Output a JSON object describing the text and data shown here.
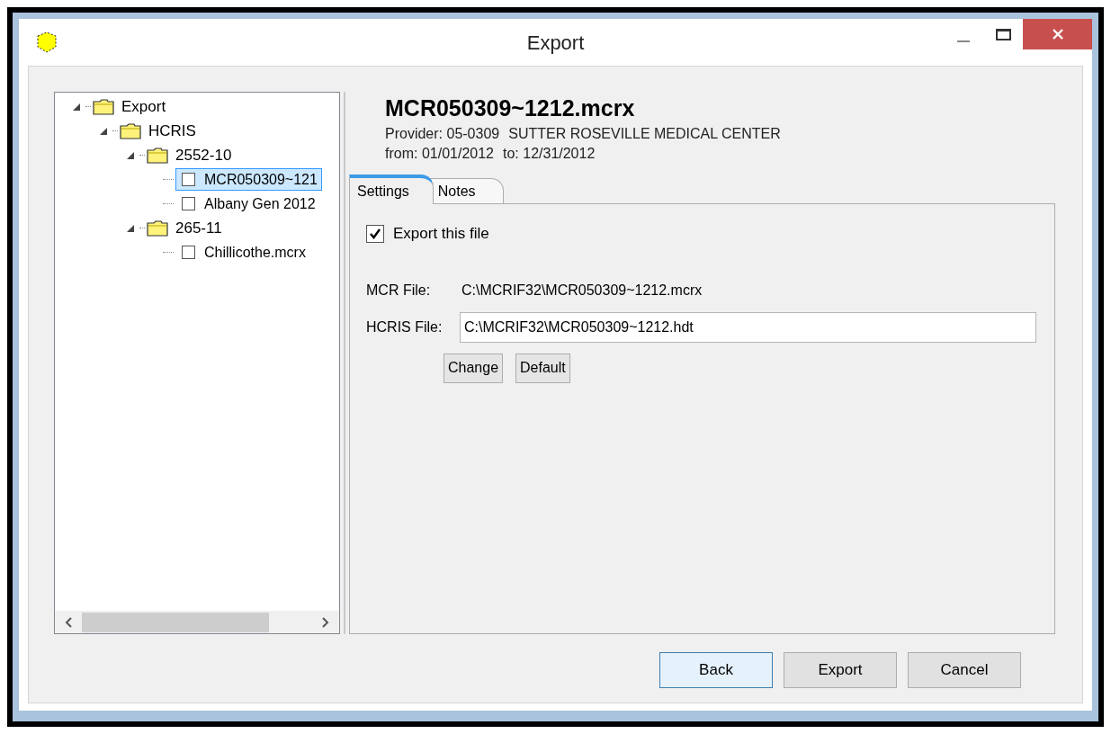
{
  "window": {
    "title": "Export"
  },
  "tree": [
    {
      "kind": "folder",
      "label": "Export",
      "expanded": true,
      "children": [
        {
          "kind": "folder",
          "label": "HCRIS",
          "expanded": true,
          "children": [
            {
              "kind": "folder",
              "label": "2552-10",
              "expanded": true,
              "children": [
                {
                  "kind": "file",
                  "label": "MCR050309~121",
                  "checked": false,
                  "selected": true
                },
                {
                  "kind": "file",
                  "label": "Albany Gen 2012",
                  "checked": false,
                  "selected": false
                }
              ]
            },
            {
              "kind": "folder",
              "label": "265-11",
              "expanded": true,
              "children": [
                {
                  "kind": "file",
                  "label": "Chillicothe.mcrx",
                  "checked": false,
                  "selected": false
                }
              ]
            }
          ]
        }
      ]
    }
  ],
  "header": {
    "title": "MCR050309~1212.mcrx",
    "provider_label": "Provider:",
    "provider_id": "05-0309",
    "provider_name": "SUTTER ROSEVILLE MEDICAL CENTER",
    "from_label": "from:",
    "from": "01/01/2012",
    "to_label": "to:",
    "to": "12/31/2012"
  },
  "tabs": [
    {
      "label": "Settings",
      "selected": true
    },
    {
      "label": "Notes",
      "selected": false
    }
  ],
  "settings": {
    "export_checkbox": {
      "label": "Export this file",
      "checked": true
    },
    "mcr_file": {
      "label": "MCR File:",
      "value": "C:\\MCRIF32\\MCR050309~1212.mcrx"
    },
    "hcris_file": {
      "label": "HCRIS File:",
      "value": "C:\\MCRIF32\\MCR050309~1212.hdt"
    },
    "buttons": [
      "Change",
      "Default"
    ]
  },
  "buttons": [
    {
      "label": "Back",
      "selected": true
    },
    {
      "label": "Export",
      "selected": false
    },
    {
      "label": "Cancel",
      "selected": false
    }
  ]
}
